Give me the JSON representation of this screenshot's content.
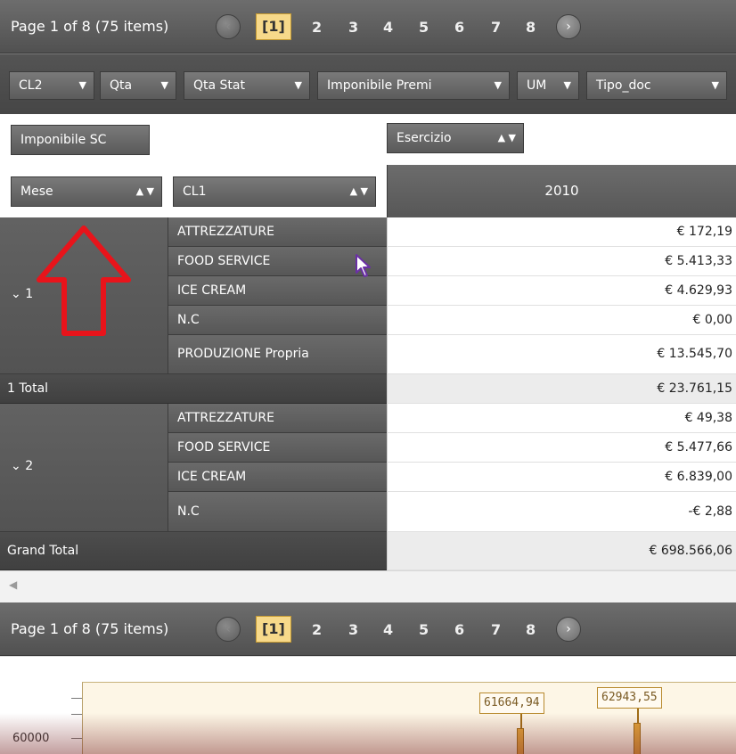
{
  "pager": {
    "summary": "Page 1 of 8 (75 items)",
    "pages": [
      "[1]",
      "2",
      "3",
      "4",
      "5",
      "6",
      "7",
      "8"
    ],
    "prev_icon": "‹",
    "next_icon": "›"
  },
  "fields": [
    {
      "label": "CL2"
    },
    {
      "label": "Qta"
    },
    {
      "label": "Qta Stat"
    },
    {
      "label": "Imponibile Premi"
    },
    {
      "label": "UM"
    },
    {
      "label": "Tipo_doc"
    }
  ],
  "header": {
    "data_field": "Imponibile SC",
    "column_field": "Esercizio",
    "row_field_1": "Mese",
    "row_field_2": "CL1",
    "year": "2010"
  },
  "groups": [
    {
      "label": "1",
      "rows": [
        {
          "name": "ATTREZZATURE",
          "value": "€ 172,19"
        },
        {
          "name": "FOOD SERVICE",
          "value": "€ 5.413,33"
        },
        {
          "name": "ICE CREAM",
          "value": "€ 4.629,93"
        },
        {
          "name": "N.C",
          "value": "€ 0,00"
        },
        {
          "name": "PRODUZIONE Propria",
          "value": "€ 13.545,70"
        }
      ],
      "total_label": "1 Total",
      "total_value": "€ 23.761,15"
    },
    {
      "label": "2",
      "rows": [
        {
          "name": "ATTREZZATURE",
          "value": "€ 49,38"
        },
        {
          "name": "FOOD SERVICE",
          "value": "€ 5.477,66"
        },
        {
          "name": "ICE CREAM",
          "value": "€ 6.839,00"
        },
        {
          "name": "N.C",
          "value": "-€ 2,88"
        }
      ]
    }
  ],
  "grand_total": {
    "label": "Grand Total",
    "value": "€ 698.566,06"
  },
  "chart": {
    "y_tick": "60000",
    "labels": [
      "61664,94",
      "62943,55"
    ]
  },
  "colors": {
    "annotation_arrow": "#e8141b",
    "active_page": "#f7d98a"
  }
}
